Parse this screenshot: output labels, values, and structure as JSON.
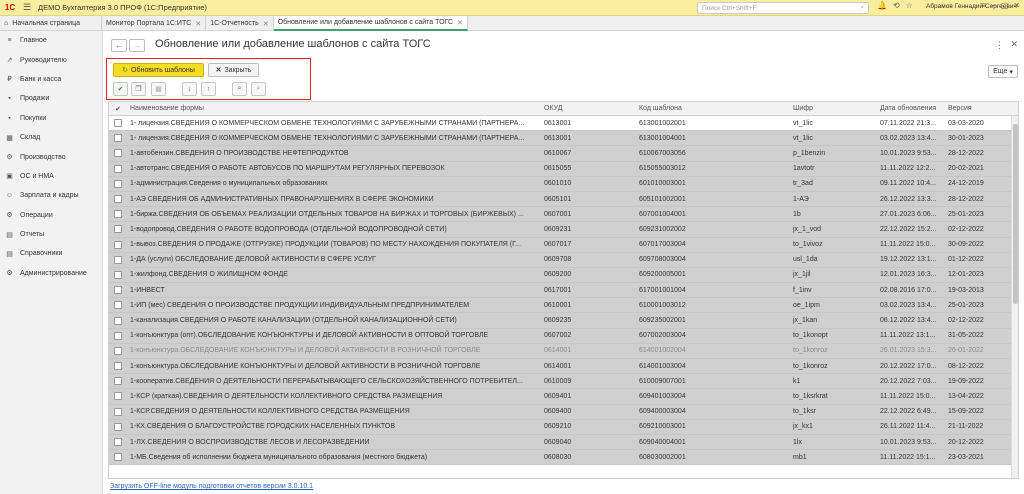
{
  "app": {
    "logo": "1С",
    "title": "ДЕМО Бухгалтерия 3.0 ПРОФ  (1С:Предприятие)",
    "search_placeholder": "Поиск Ctrl+Shift+F",
    "user": "Абрамов Геннадий Сергеевич"
  },
  "tabs": [
    {
      "label": "Начальная страница",
      "closable": false
    },
    {
      "label": "Монитор Портала 1С:ИТС",
      "closable": true
    },
    {
      "label": "1С-Отчетность",
      "closable": true
    },
    {
      "label": "Обновление или добавление шаблонов с сайта ТОГС",
      "closable": true
    }
  ],
  "sidebar": [
    {
      "label": "Главное",
      "icon": "≡"
    },
    {
      "label": "Руководителю",
      "icon": "↗"
    },
    {
      "label": "Банк и касса",
      "icon": "₽"
    },
    {
      "label": "Продажи",
      "icon": "▪"
    },
    {
      "label": "Покупки",
      "icon": "▪"
    },
    {
      "label": "Склад",
      "icon": "▦"
    },
    {
      "label": "Производство",
      "icon": "⚙"
    },
    {
      "label": "ОС и НМА",
      "icon": "▣"
    },
    {
      "label": "Зарплата и кадры",
      "icon": "☺"
    },
    {
      "label": "Операции",
      "icon": "⚙"
    },
    {
      "label": "Отчеты",
      "icon": "▤"
    },
    {
      "label": "Справочники",
      "icon": "▤"
    },
    {
      "label": "Администрирование",
      "icon": "⚙"
    }
  ],
  "page": {
    "title": "Обновление или добавление шаблонов с сайта ТОГС",
    "update_button": "Обновить шаблоны",
    "close_button": "Закрыть",
    "more_button": "Еще",
    "footer_link": "Загрузить OFF-line модуль подготовки отчетов версии 3.0.10.1"
  },
  "table": {
    "headers": [
      "Наименование формы",
      "ОКУД",
      "Код шаблона",
      "Шифр",
      "Дата обновления",
      "Версия"
    ],
    "rows": [
      {
        "name": "1- лицензия.СВЕДЕНИЯ О КОММЕРЧЕСКОМ ОБМЕНЕ ТЕХНОЛОГИЯМИ С ЗАРУБЕЖНЫМИ СТРАНАМИ (ПАРТНЕРА...",
        "okud": "0613001",
        "code": "613001002001",
        "cipher": "vt_1lic",
        "date": "07.11.2022 21:3...",
        "version": "03-03-2020",
        "style": "first"
      },
      {
        "name": "1- лицензия.СВЕДЕНИЯ О КОММЕРЧЕСКОМ ОБМЕНЕ ТЕХНОЛОГИЯМИ С ЗАРУБЕЖНЫМИ СТРАНАМИ (ПАРТНЕРА...",
        "okud": "0613001",
        "code": "613001004001",
        "cipher": "vt_1lic",
        "date": "03.02.2023 13:4...",
        "version": "30-01-2023",
        "style": ""
      },
      {
        "name": "1-автобензин.СВЕДЕНИЯ О ПРОИЗВОДСТВЕ НЕФТЕПРОДУКТОВ",
        "okud": "0610067",
        "code": "610067003056",
        "cipher": "p_1benzin",
        "date": "10.01.2023 9:53...",
        "version": "28-12-2022",
        "style": ""
      },
      {
        "name": "1-автотранс.СВЕДЕНИЯ О РАБОТЕ АВТОБУСОВ ПО МАРШРУТАМ РЕГУЛЯРНЫХ ПЕРЕВОЗОК",
        "okud": "0615055",
        "code": "615055003012",
        "cipher": "1avtotr",
        "date": "11.11.2022 12:2...",
        "version": "20-02-2021",
        "style": ""
      },
      {
        "name": "1-администрация.Сведения о муниципальных образованиях",
        "okud": "0601010",
        "code": "601010003001",
        "cipher": "tr_3ad",
        "date": "09.11.2022 10:4...",
        "version": "24-12-2019",
        "style": ""
      },
      {
        "name": "1-АЭ СВЕДЕНИЯ ОБ АДМИНИСТРАТИВНЫХ ПРАВОНАРУШЕНИЯХ В СФЕРЕ ЭКОНОМИКИ",
        "okud": "0605101",
        "code": "605101002001",
        "cipher": "1-АЭ",
        "date": "26.12.2022 13:3...",
        "version": "28-12-2022",
        "style": ""
      },
      {
        "name": "1-биржа.СВЕДЕНИЯ ОБ ОБЪЕМАХ РЕАЛИЗАЦИИ ОТДЕЛЬНЫХ ТОВАРОВ НА БИРЖАХ И ТОРГОВЫХ (БИРЖЕВЫХ) ...",
        "okud": "0607001",
        "code": "607001004001",
        "cipher": "1b",
        "date": "27.01.2023 6:06...",
        "version": "25-01-2023",
        "style": ""
      },
      {
        "name": "1-водопровод.СВЕДЕНИЯ О РАБОТЕ ВОДОПРОВОДА (ОТДЕЛЬНОЙ ВОДОПРОВОДНОЙ СЕТИ)",
        "okud": "0609231",
        "code": "609231002002",
        "cipher": "jx_1_vod",
        "date": "22.12.2022 15:2...",
        "version": "02-12-2022",
        "style": ""
      },
      {
        "name": "1-вывоз.СВЕДЕНИЯ О ПРОДАЖЕ (ОТГРУЗКЕ) ПРОДУКЦИИ (ТОВАРОВ) ПО МЕСТУ НАХОЖДЕНИЯ ПОКУПАТЕЛЯ (Г...",
        "okud": "0607017",
        "code": "607017003004",
        "cipher": "to_1vivoz",
        "date": "11.11.2022 15:0...",
        "version": "30-09-2022",
        "style": ""
      },
      {
        "name": "1-ДА (услуги) ОБСЛЕДОВАНИЕ ДЕЛОВОЙ АКТИВНОСТИ В СФЕРЕ УСЛУГ",
        "okud": "0609708",
        "code": "609708003004",
        "cipher": "usl_1da",
        "date": "19.12.2022 13:1...",
        "version": "01-12-2022",
        "style": ""
      },
      {
        "name": "1-жилфонд.СВЕДЕНИЯ О ЖИЛИЩНОМ ФОНДЕ",
        "okud": "0609200",
        "code": "609200005001",
        "cipher": "jx_1jil",
        "date": "12.01.2023 16:3...",
        "version": "12-01-2023",
        "style": ""
      },
      {
        "name": "1-ИНВЕСТ",
        "okud": "0617001",
        "code": "617001001004",
        "cipher": "f_1inv",
        "date": "02.08.2016 17:0...",
        "version": "19-03-2013",
        "style": ""
      },
      {
        "name": "1-ИП (мес) СВЕДЕНИЯ О ПРОИЗВОДСТВЕ ПРОДУКЦИИ ИНДИВИДУАЛЬНЫМ ПРЕДПРИНИМАТЕЛЕМ",
        "okud": "0610001",
        "code": "610001003012",
        "cipher": "oe_1ipm",
        "date": "03.02.2023 13:4...",
        "version": "25-01-2023",
        "style": ""
      },
      {
        "name": "1-канализация.СВЕДЕНИЯ О РАБОТЕ КАНАЛИЗАЦИИ (ОТДЕЛЬНОЙ КАНАЛИЗАЦИОННОЙ СЕТИ)",
        "okud": "0609235",
        "code": "609235002001",
        "cipher": "jx_1kan",
        "date": "06.12.2022 13:4...",
        "version": "02-12-2022",
        "style": ""
      },
      {
        "name": "1-конъюнктура (опт).ОБСЛЕДОВАНИЕ КОНЪЮНКТУРЫ И ДЕЛОВОЙ АКТИВНОСТИ В ОПТОВОЙ ТОРГОВЛЕ",
        "okud": "0607002",
        "code": "607002003004",
        "cipher": "to_1konopt",
        "date": "11.11.2022 13:1...",
        "version": "31-05-2022",
        "style": ""
      },
      {
        "name": "1-конъюнктура.ОБСЛЕДОВАНИЕ КОНЪЮНКТУРЫ И ДЕЛОВОЙ АКТИВНОСТИ В РОЗНИЧНОЙ ТОРГОВЛЕ",
        "okud": "0614001",
        "code": "614001002004",
        "cipher": "to_1konroz",
        "date": "26.01.2023 15:3...",
        "version": "26-01-2022",
        "style": "gray"
      },
      {
        "name": "1-конъюнктура.ОБСЛЕДОВАНИЕ КОНЪЮНКТУРЫ И ДЕЛОВОЙ АКТИВНОСТИ В РОЗНИЧНОЙ ТОРГОВЛЕ",
        "okud": "0614001",
        "code": "614001003004",
        "cipher": "to_1konroz",
        "date": "20.12.2022 17:0...",
        "version": "08-12-2022",
        "style": ""
      },
      {
        "name": "1-кооператив.СВЕДЕНИЯ О ДЕЯТЕЛЬНОСТИ ПЕРЕРАБАТЫВАЮЩЕГО СЕЛЬСКОХОЗЯЙСТВЕННОГО ПОТРЕБИТЕЛ...",
        "okud": "0610009",
        "code": "610009007001",
        "cipher": "k1",
        "date": "20.12.2022 7:03...",
        "version": "19-09-2022",
        "style": ""
      },
      {
        "name": "1-КСР (краткая).СВЕДЕНИЯ О ДЕЯТЕЛЬНОСТИ КОЛЛЕКТИВНОГО СРЕДСТВА РАЗМЕЩЕНИЯ",
        "okud": "0609401",
        "code": "609401003004",
        "cipher": "to_1ksrkrat",
        "date": "11.11.2022 15:0...",
        "version": "13-04-2022",
        "style": ""
      },
      {
        "name": "1-КСР.СВЕДЕНИЯ О ДЕЯТЕЛЬНОСТИ КОЛЛЕКТИВНОГО СРЕДСТВА РАЗМЕЩЕНИЯ",
        "okud": "0609400",
        "code": "609400003004",
        "cipher": "to_1ksr",
        "date": "22.12.2022 6:49...",
        "version": "15-09-2022",
        "style": ""
      },
      {
        "name": "1-КХ.СВЕДЕНИЯ О БЛАГОУСТРОЙСТВЕ ГОРОДСКИХ НАСЕЛЕННЫХ ПУНКТОВ",
        "okud": "0609210",
        "code": "609210003001",
        "cipher": "jx_kx1",
        "date": "26.11.2022 11:4...",
        "version": "21-11-2022",
        "style": ""
      },
      {
        "name": "1-ЛХ.СВЕДЕНИЯ О ВОСПРОИЗВОДСТВЕ ЛЕСОВ И ЛЕСОРАЗВЕДЕНИИ",
        "okud": "0609040",
        "code": "609040004001",
        "cipher": "1lx",
        "date": "10.01.2023 9:53...",
        "version": "20-12-2022",
        "style": ""
      },
      {
        "name": "1-МБ.Сведения об исполнении бюджета муниципального образования (местного бюджета)",
        "okud": "0608030",
        "code": "608030002001",
        "cipher": "mb1",
        "date": "11.11.2022 15:1...",
        "version": "23-03-2021",
        "style": ""
      }
    ]
  }
}
